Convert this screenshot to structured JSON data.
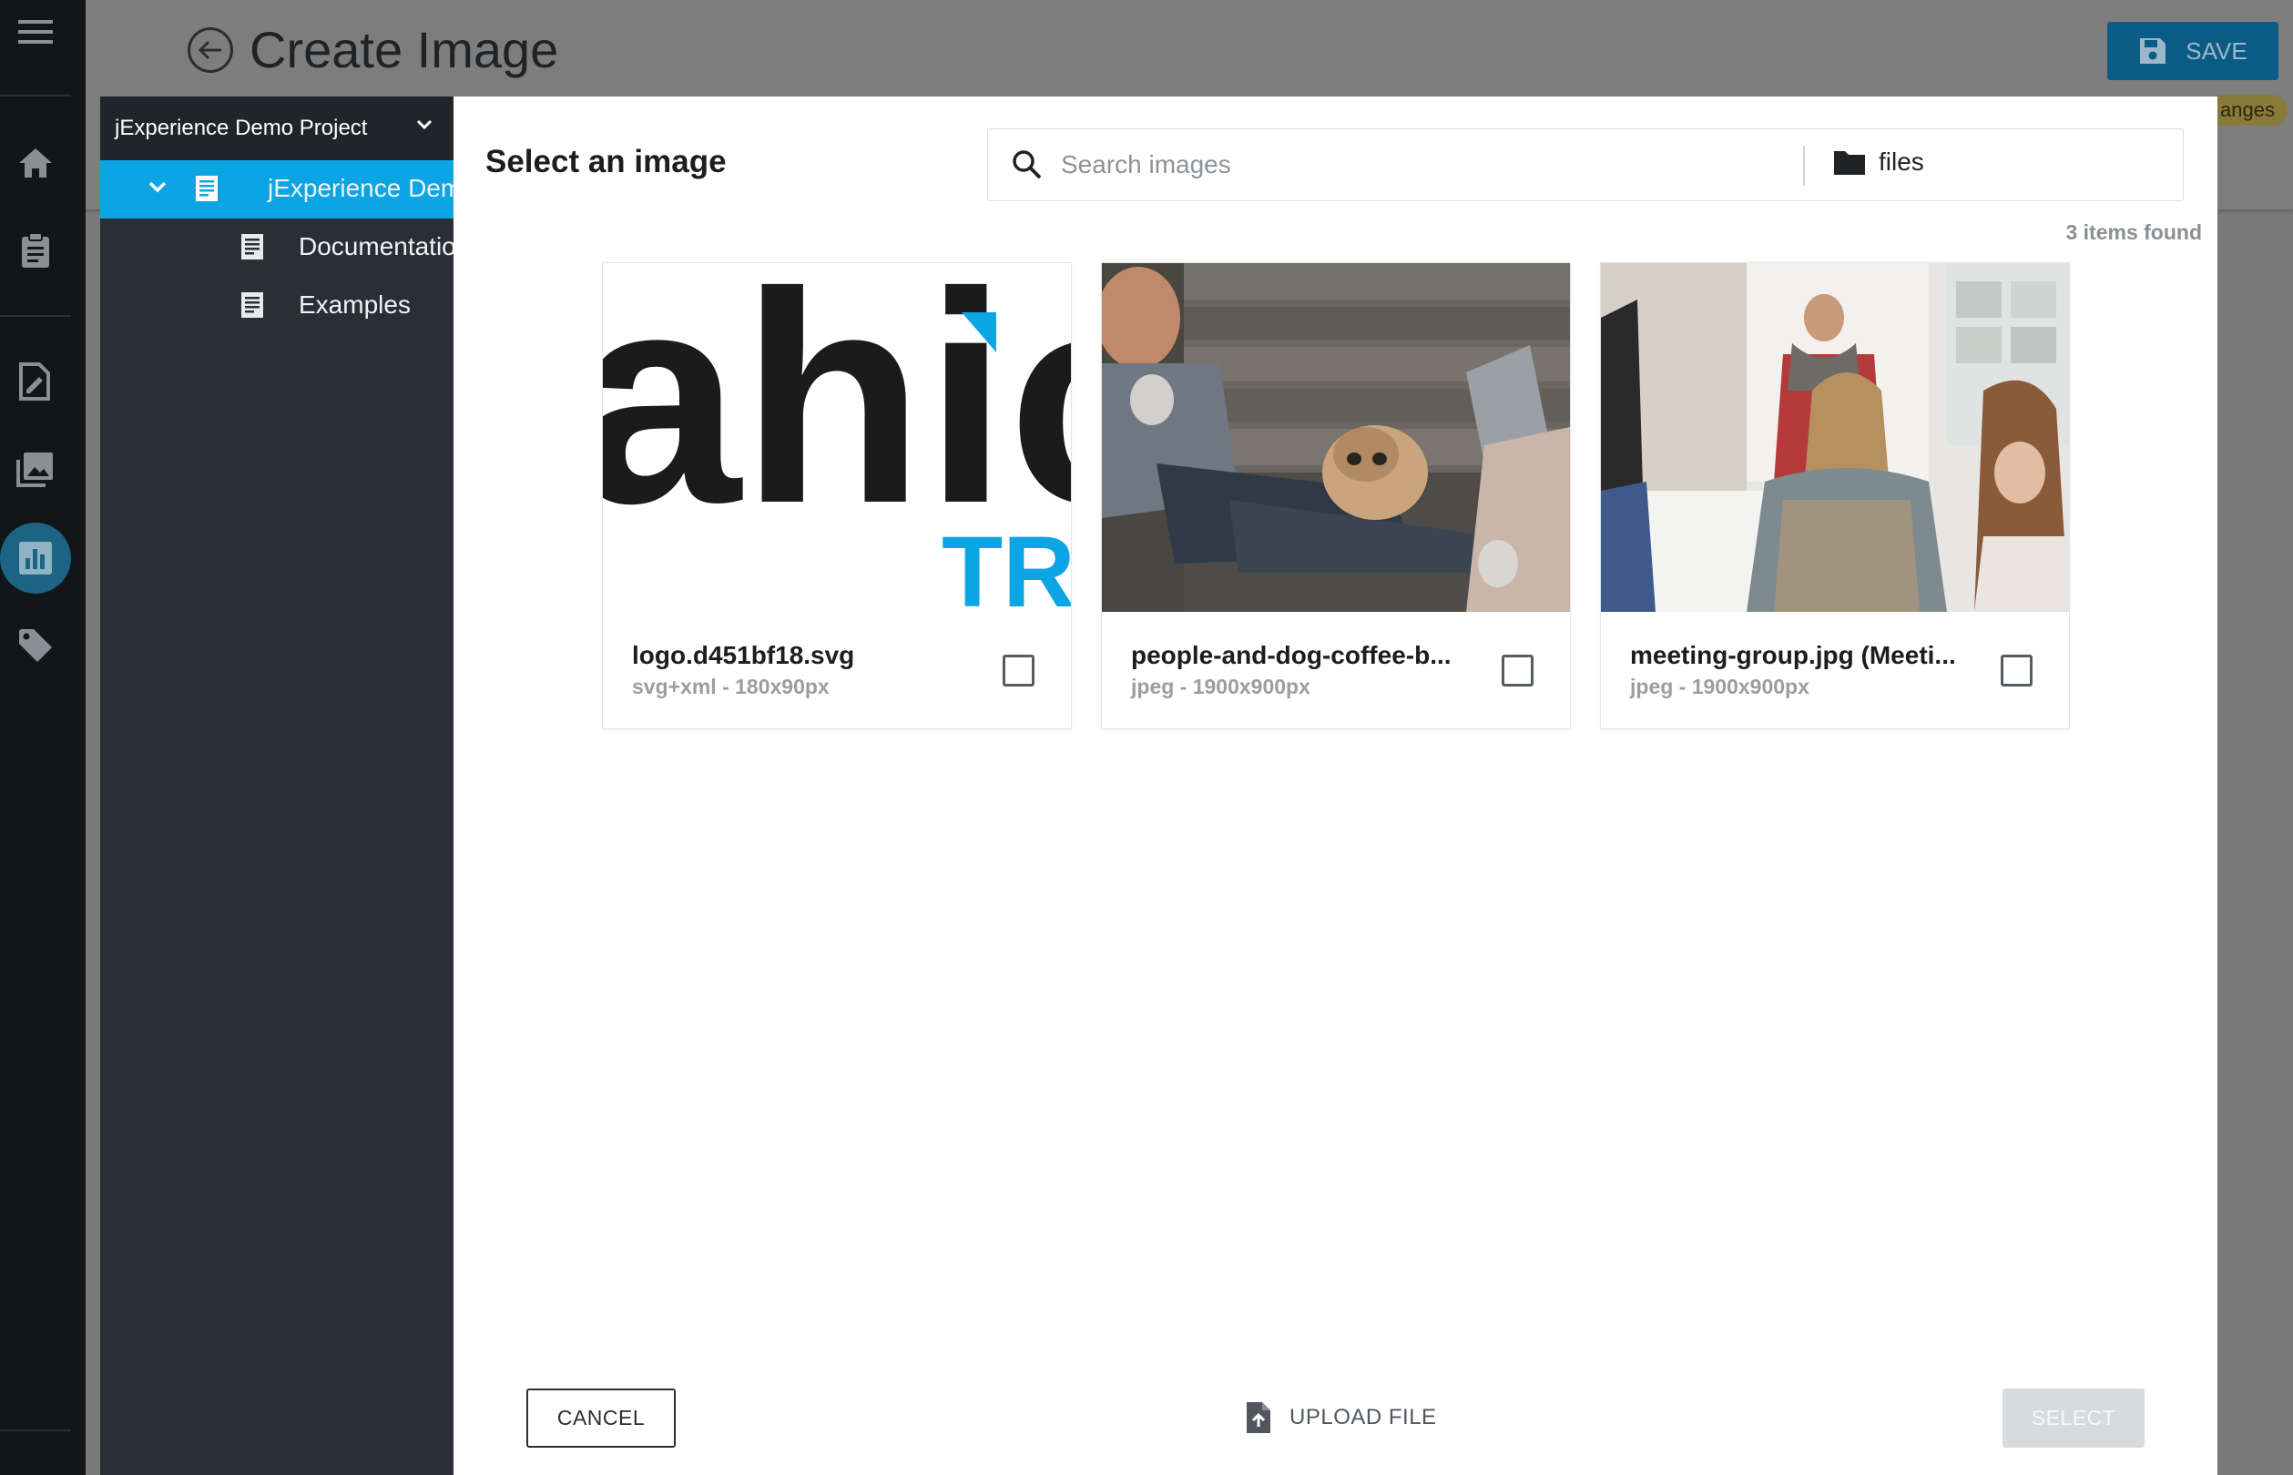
{
  "background": {
    "title": "Create Image",
    "save_label": "SAVE",
    "badge_text": "anges"
  },
  "tree": {
    "header": "jExperience Demo Project",
    "items": [
      {
        "label": "jExperience Demo",
        "selected": true
      },
      {
        "label": "Documentation"
      },
      {
        "label": "Examples"
      }
    ]
  },
  "modal": {
    "title": "Select an image",
    "search_placeholder": "Search images",
    "folder_label": "files",
    "count_text": "3 items found",
    "cards": [
      {
        "name": "logo.d451bf18.svg",
        "meta": "svg+xml - 180x90px",
        "logo_text": "ahic",
        "logo_sub": "TRI"
      },
      {
        "name": "people-and-dog-coffee-b...",
        "meta": "jpeg - 1900x900px"
      },
      {
        "name": "meeting-group.jpg (Meeti...",
        "meta": "jpeg - 1900x900px"
      }
    ],
    "cancel_label": "CANCEL",
    "upload_label": "UPLOAD FILE",
    "select_label": "SELECT"
  },
  "colors": {
    "accent": "#0ca5e4",
    "save": "#0b5b87",
    "rail": "#121619",
    "tree": "#292f35"
  }
}
